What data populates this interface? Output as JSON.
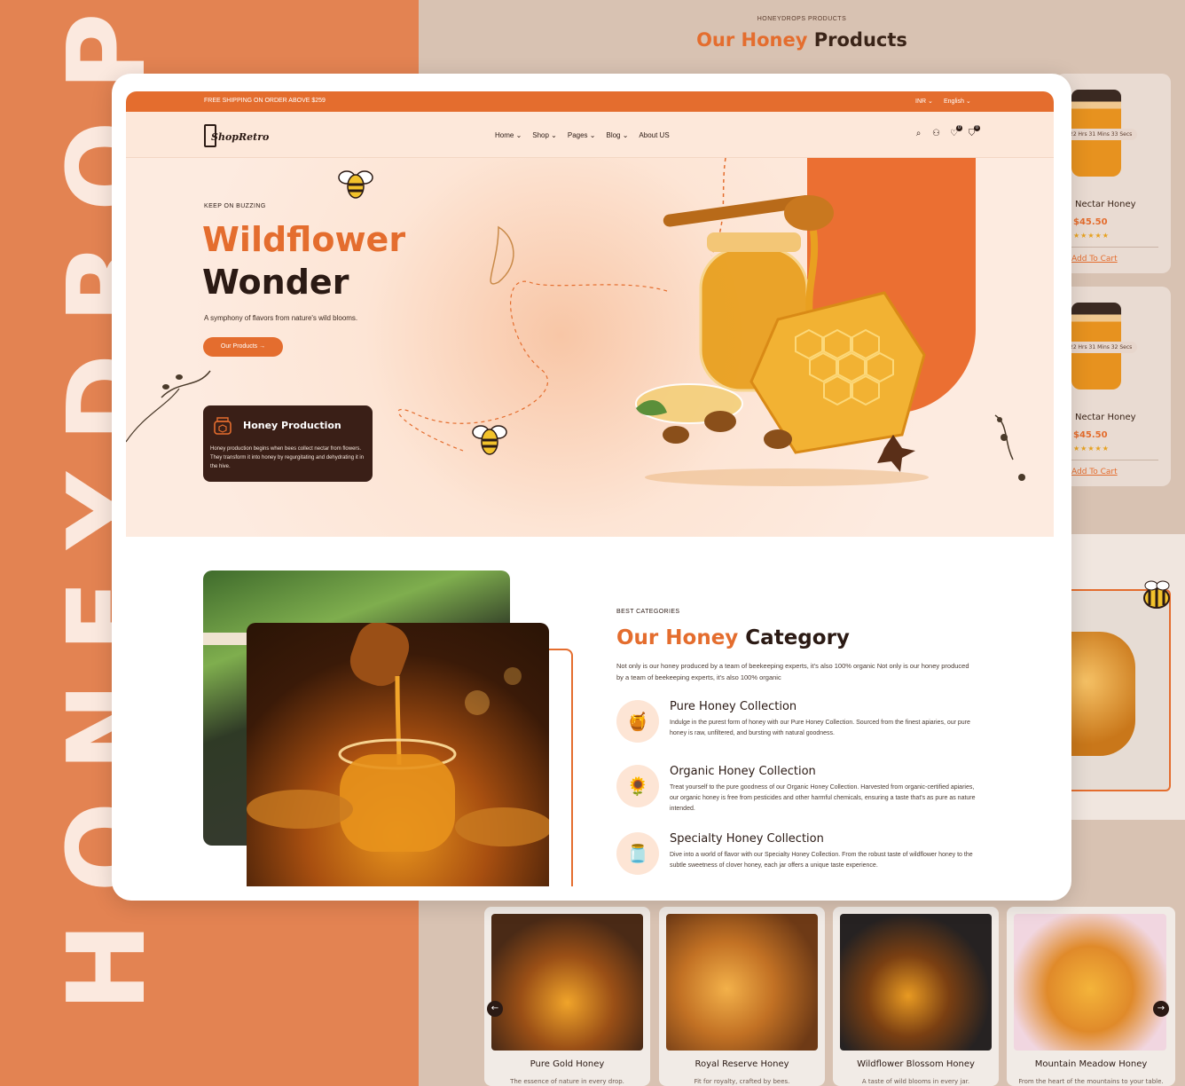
{
  "showcase": {
    "brand_vertical": "HONEYDROPS",
    "bg_kicker": "HONEYDROPS PRODUCTS",
    "bg_title_accent": "Our Honey",
    "bg_title_rest": " Products",
    "side_products": [
      {
        "name": "Nectar Honey",
        "price": "$45.50",
        "stars": "★★★★★",
        "cart": "Add To Cart",
        "timer": "22 Hrs  31 Mins  33 Secs"
      },
      {
        "name": "Nectar Honey",
        "price": "$45.50",
        "stars": "★★★★★",
        "cart": "Add To Cart",
        "timer": "22 Hrs  31 Mins  32 Secs"
      }
    ],
    "bottom_products": [
      {
        "name": "Pure Gold Honey",
        "desc": "The essence of nature in every drop."
      },
      {
        "name": "Royal Reserve Honey",
        "desc": "Fit for royalty, crafted by bees."
      },
      {
        "name": "Wildflower Blossom Honey",
        "desc": "A taste of wild blooms in every jar."
      },
      {
        "name": "Mountain Meadow Honey",
        "desc": "From the heart of the mountains to your table."
      }
    ]
  },
  "topbar": {
    "shipping": "FREE SHIPPING ON ORDER ABOVE $259",
    "currency": "INR ⌄",
    "language": "English ⌄"
  },
  "nav": {
    "logo": "ShopRetro",
    "menu": [
      "Home ⌄",
      "Shop ⌄",
      "Pages ⌄",
      "Blog ⌄",
      "About US"
    ],
    "wishlist_count": "0",
    "cart_count": "0"
  },
  "hero": {
    "kicker": "KEEP ON BUZZING",
    "title_line1": "Wildflower",
    "title_line2": "Wonder",
    "subtitle": "A symphony of flavors from nature's wild blooms.",
    "cta": "Our Products  →",
    "info_title": "Honey Production",
    "info_text": "Honey production begins when bees collect nectar from flowers. They transform it into honey by regurgitating and dehydrating it in the hive."
  },
  "categories": {
    "kicker": "BEST CATEGORIES",
    "title_accent": "Our Honey",
    "title_rest": " Category",
    "description": "Not only is our honey produced by a team of beekeeping experts, it's also 100% organic Not only is our honey produced by a team of beekeeping experts, it's also 100% organic",
    "items": [
      {
        "title": "Pure Honey Collection",
        "text": "Indulge in the purest form of honey with our Pure Honey Collection. Sourced from the finest apiaries, our pure honey is raw, unfiltered, and bursting with natural goodness."
      },
      {
        "title": "Organic Honey Collection",
        "text": "Treat yourself to the pure goodness of our Organic Honey Collection. Harvested from organic-certified apiaries, our organic honey is free from pesticides and other harmful chemicals, ensuring a taste that's as pure as nature intended."
      },
      {
        "title": "Specialty Honey Collection",
        "text": "Dive into a world of flavor with our Specialty Honey Collection. From the robust taste of wildflower honey to the subtle sweetness of clover honey, each jar offers a unique taste experience."
      }
    ]
  },
  "colors": {
    "accent": "#e46d2e",
    "dark": "#2b1a14",
    "cream": "#fde8da",
    "showcase_bg": "#d8c2b2"
  }
}
